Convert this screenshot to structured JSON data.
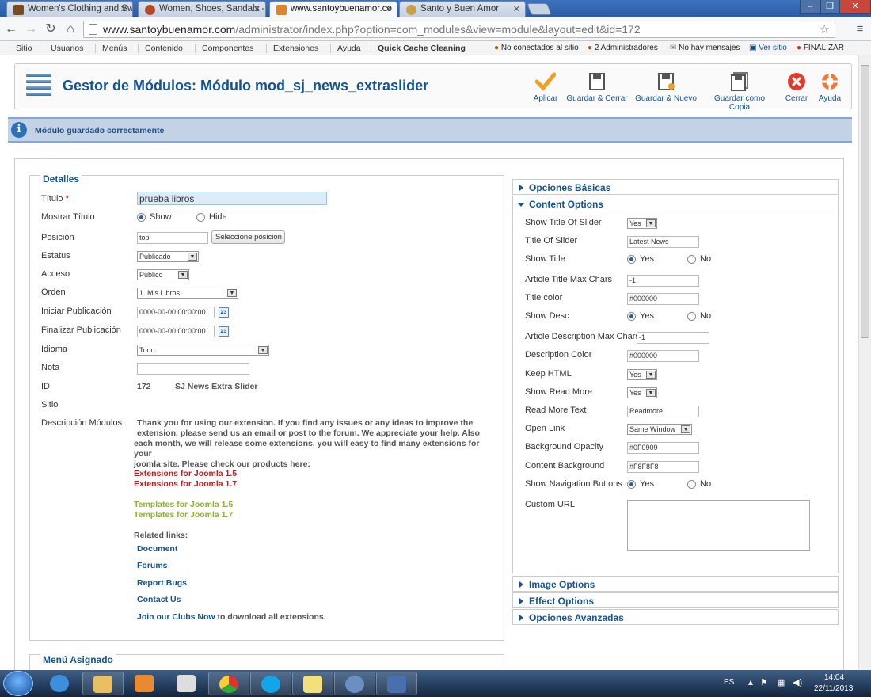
{
  "browser": {
    "tabs": [
      {
        "title": "Women's Clothing and Sw",
        "color": "#7a4a1a"
      },
      {
        "title": "Women, Shoes, Sandals -",
        "color": "#b24a2a"
      },
      {
        "title": "www.santoybuenamor.co",
        "color": "#e0842a"
      },
      {
        "title": "Santo y Buen Amor",
        "color": "#c7a24a"
      }
    ],
    "url_host": "www.santoybuenamor.com",
    "url_path": "/administrator/index.php?option=com_modules&view=module&layout=edit&id=172"
  },
  "admin_menu": {
    "items": [
      "Sitio",
      "Usuarios",
      "Menús",
      "Contenido",
      "Componentes",
      "Extensiones",
      "Ayuda",
      "Quick Cache Cleaning"
    ],
    "status": [
      "No conectados al sitio",
      "2 Administradores",
      "No hay mensajes",
      "Ver sitio",
      "FINALIZAR"
    ]
  },
  "page": {
    "title": "Gestor de Módulos: Módulo mod_sj_news_extraslider",
    "message": "Módulo guardado correctamente"
  },
  "toolbar": {
    "apply": "Aplicar",
    "save_close": "Guardar & Cerrar",
    "save_new": "Guardar & Nuevo",
    "save_copy": "Guardar como Copia",
    "close": "Cerrar",
    "help": "Ayuda"
  },
  "details": {
    "legend": "Detalles",
    "title_label": "Título",
    "title_value": "prueba libros",
    "show_title_label": "Mostrar Título",
    "show": "Show",
    "hide": "Hide",
    "position_label": "Posición",
    "position_value": "top",
    "position_button": "Seleccione posicion",
    "status_label": "Estatus",
    "status_value": "Publicado",
    "access_label": "Acceso",
    "access_value": "Público",
    "order_label": "Orden",
    "order_value": "1. Mis Libros",
    "start_label": "Iniciar Publicación",
    "start_value": "0000-00-00 00:00:00",
    "finish_label": "Finalizar Publicación",
    "finish_value": "0000-00-00 00:00:00",
    "calendar_icon_text": "23",
    "language_label": "Idioma",
    "language_value": "Todo",
    "note_label": "Nota",
    "id_label": "ID",
    "id_value": "172",
    "id_name": "SJ News Extra Slider",
    "site_label": "Sitio",
    "desc_label": "Descripción Módulos",
    "desc_text_1": "Thank you for using our extension. If you find any issues or any ideas to improve the",
    "desc_text_2": "extension, please send us an email or post to the forum. We appreciate your help. Also",
    "desc_text_3": "each month, we will release some extensions, you will easy to find many extensions for your",
    "desc_text_4": "joomla site. Please check our products here:",
    "ext15": "Extensions for Joomla 1.5",
    "ext17": "Extensions for Joomla 1.7",
    "tpl15": "Templates for Joomla 1.5",
    "tpl17": "Templates for Joomla 1.7",
    "related": "Related links:",
    "link_doc": "Document",
    "link_forums": "Forums",
    "link_bugs": "Report Bugs",
    "link_contact": "Contact Us",
    "join_link": "Join our Clubs Now",
    "join_rest": " to download all extensions.",
    "menu_assigned": "Menú Asignado"
  },
  "panels": {
    "basic": "Opciones Básicas",
    "content": "Content Options",
    "image": "Image Options",
    "effect": "Effect Options",
    "advanced": "Opciones Avanzadas"
  },
  "content_options": {
    "show_title_slider_label": "Show Title Of Slider",
    "show_title_slider_value": "Yes",
    "title_slider_label": "Title Of Slider",
    "title_slider_value": "Latest News",
    "show_title_label": "Show Title",
    "yes": "Yes",
    "no": "No",
    "article_title_max_label": "Article Title Max Chars",
    "article_title_max_value": "-1",
    "title_color_label": "Title color",
    "title_color_value": "#000000",
    "show_desc_label": "Show Desc",
    "article_desc_max_label": "Article Description Max Chars",
    "article_desc_max_value": "-1",
    "desc_color_label": "Description Color",
    "desc_color_value": "#000000",
    "keep_html_label": "Keep HTML",
    "keep_html_value": "Yes",
    "show_read_more_label": "Show Read More",
    "show_read_more_value": "Yes",
    "read_more_text_label": "Read More Text",
    "read_more_text_value": "Readmore",
    "open_link_label": "Open Link",
    "open_link_value": "Same Window",
    "bg_opacity_label": "Background Opacity",
    "bg_opacity_value": "#0F0909",
    "content_bg_label": "Content Background",
    "content_bg_value": "#F8F8F8",
    "show_nav_label": "Show Navigation Buttons",
    "custom_url_label": "Custom URL"
  },
  "taskbar": {
    "lang": "ES",
    "time": "14:04",
    "date": "22/11/2013"
  }
}
